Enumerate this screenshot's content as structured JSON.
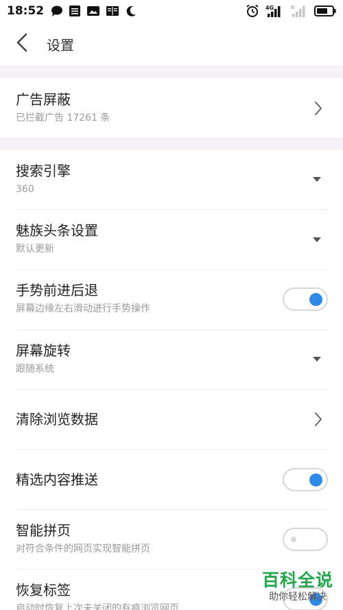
{
  "status_bar": {
    "time": "18:52",
    "left_icons": [
      "chat-bubble-icon",
      "list-app-icon",
      "image-message-icon",
      "book-icon",
      "moon-icon"
    ],
    "right_icons": [
      "alarm-clock-icon",
      "signal-4g-icon",
      "signal-empty-icon",
      "battery-icon"
    ],
    "network_label": "4G"
  },
  "header": {
    "title": "设置"
  },
  "settings": [
    {
      "title": "广告屏蔽",
      "subtitle": "已拦截广告 17261 条",
      "control": "chevron"
    },
    {
      "title": "搜索引擎",
      "subtitle": "360",
      "control": "dropdown"
    },
    {
      "title": "魅族头条设置",
      "subtitle": "默认更新",
      "control": "dropdown"
    },
    {
      "title": "手势前进后退",
      "subtitle": "屏幕边缘左右滑动进行手势操作",
      "control": "toggle",
      "state": "on"
    },
    {
      "title": "屏幕旋转",
      "subtitle": "跟随系统",
      "control": "dropdown"
    },
    {
      "title": "清除浏览数据",
      "subtitle": "",
      "control": "chevron"
    },
    {
      "title": "精选内容推送",
      "subtitle": "",
      "control": "toggle",
      "state": "on"
    },
    {
      "title": "智能拼页",
      "subtitle": "对符合条件的网页实现智能拼页",
      "control": "toggle",
      "state": "off"
    },
    {
      "title": "恢复标签",
      "subtitle": "启动时恢复上次未关闭的有痕浏览网页",
      "control": "toggle",
      "state": "on"
    }
  ],
  "watermark": {
    "title": "百科全说",
    "subtitle": "助你轻松解决"
  },
  "colors": {
    "accent": "#2d8ae8",
    "section_gap": "#f5f3f7",
    "watermark_green": "#21a84a"
  }
}
